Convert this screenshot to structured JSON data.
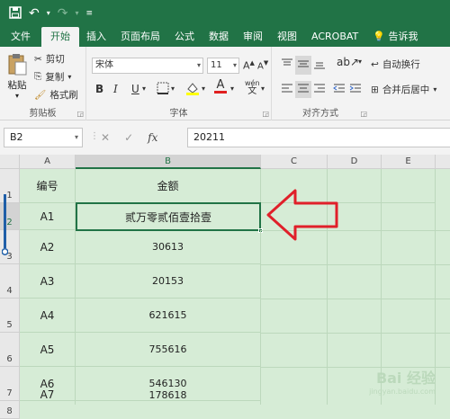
{
  "title_bar": {
    "save_icon": "save-icon",
    "undo_icon": "undo-icon",
    "redo_icon": "redo-icon"
  },
  "menu": {
    "tabs": [
      "文件",
      "开始",
      "插入",
      "页面布局",
      "公式",
      "数据",
      "审阅",
      "视图",
      "ACROBAT",
      "告诉我"
    ],
    "active": "开始"
  },
  "ribbon": {
    "clipboard": {
      "paste": "粘贴",
      "cut": "剪切",
      "copy": "复制",
      "format_painter": "格式刷",
      "group_label": "剪贴板"
    },
    "font": {
      "font_name": "宋体",
      "font_size": "11",
      "bold": "B",
      "italic": "I",
      "underline": "U",
      "wen": "wén",
      "wen2": "文",
      "group_label": "字体"
    },
    "alignment": {
      "wrap_text": "自动换行",
      "merge_center": "合并后居中",
      "group_label": "对齐方式"
    }
  },
  "formula_bar": {
    "name_box": "B2",
    "cancel": "✕",
    "enter": "✓",
    "fx": "fx",
    "content": "20211"
  },
  "sheet": {
    "columns": [
      "A",
      "B",
      "C",
      "D",
      "E"
    ],
    "rows": [
      "1",
      "2",
      "3",
      "4",
      "5",
      "6",
      "7",
      "8"
    ],
    "header_row": {
      "a": "编号",
      "b": "金额"
    },
    "data": [
      {
        "a": "A1",
        "b": "贰万零贰佰壹拾壹"
      },
      {
        "a": "A2",
        "b": "30613"
      },
      {
        "a": "A3",
        "b": "20153"
      },
      {
        "a": "A4",
        "b": "621615"
      },
      {
        "a": "A5",
        "b": "755616"
      },
      {
        "a": "A6",
        "b": "546130"
      },
      {
        "a": "A7",
        "b": "178618"
      }
    ],
    "active_cell": "B2"
  },
  "watermark": {
    "text": "Bai 经验",
    "sub": "jingyan.baidu.com"
  },
  "colors": {
    "accent": "#217346",
    "arrow": "#e0202a",
    "grid_bg": "#d6ecd6"
  }
}
